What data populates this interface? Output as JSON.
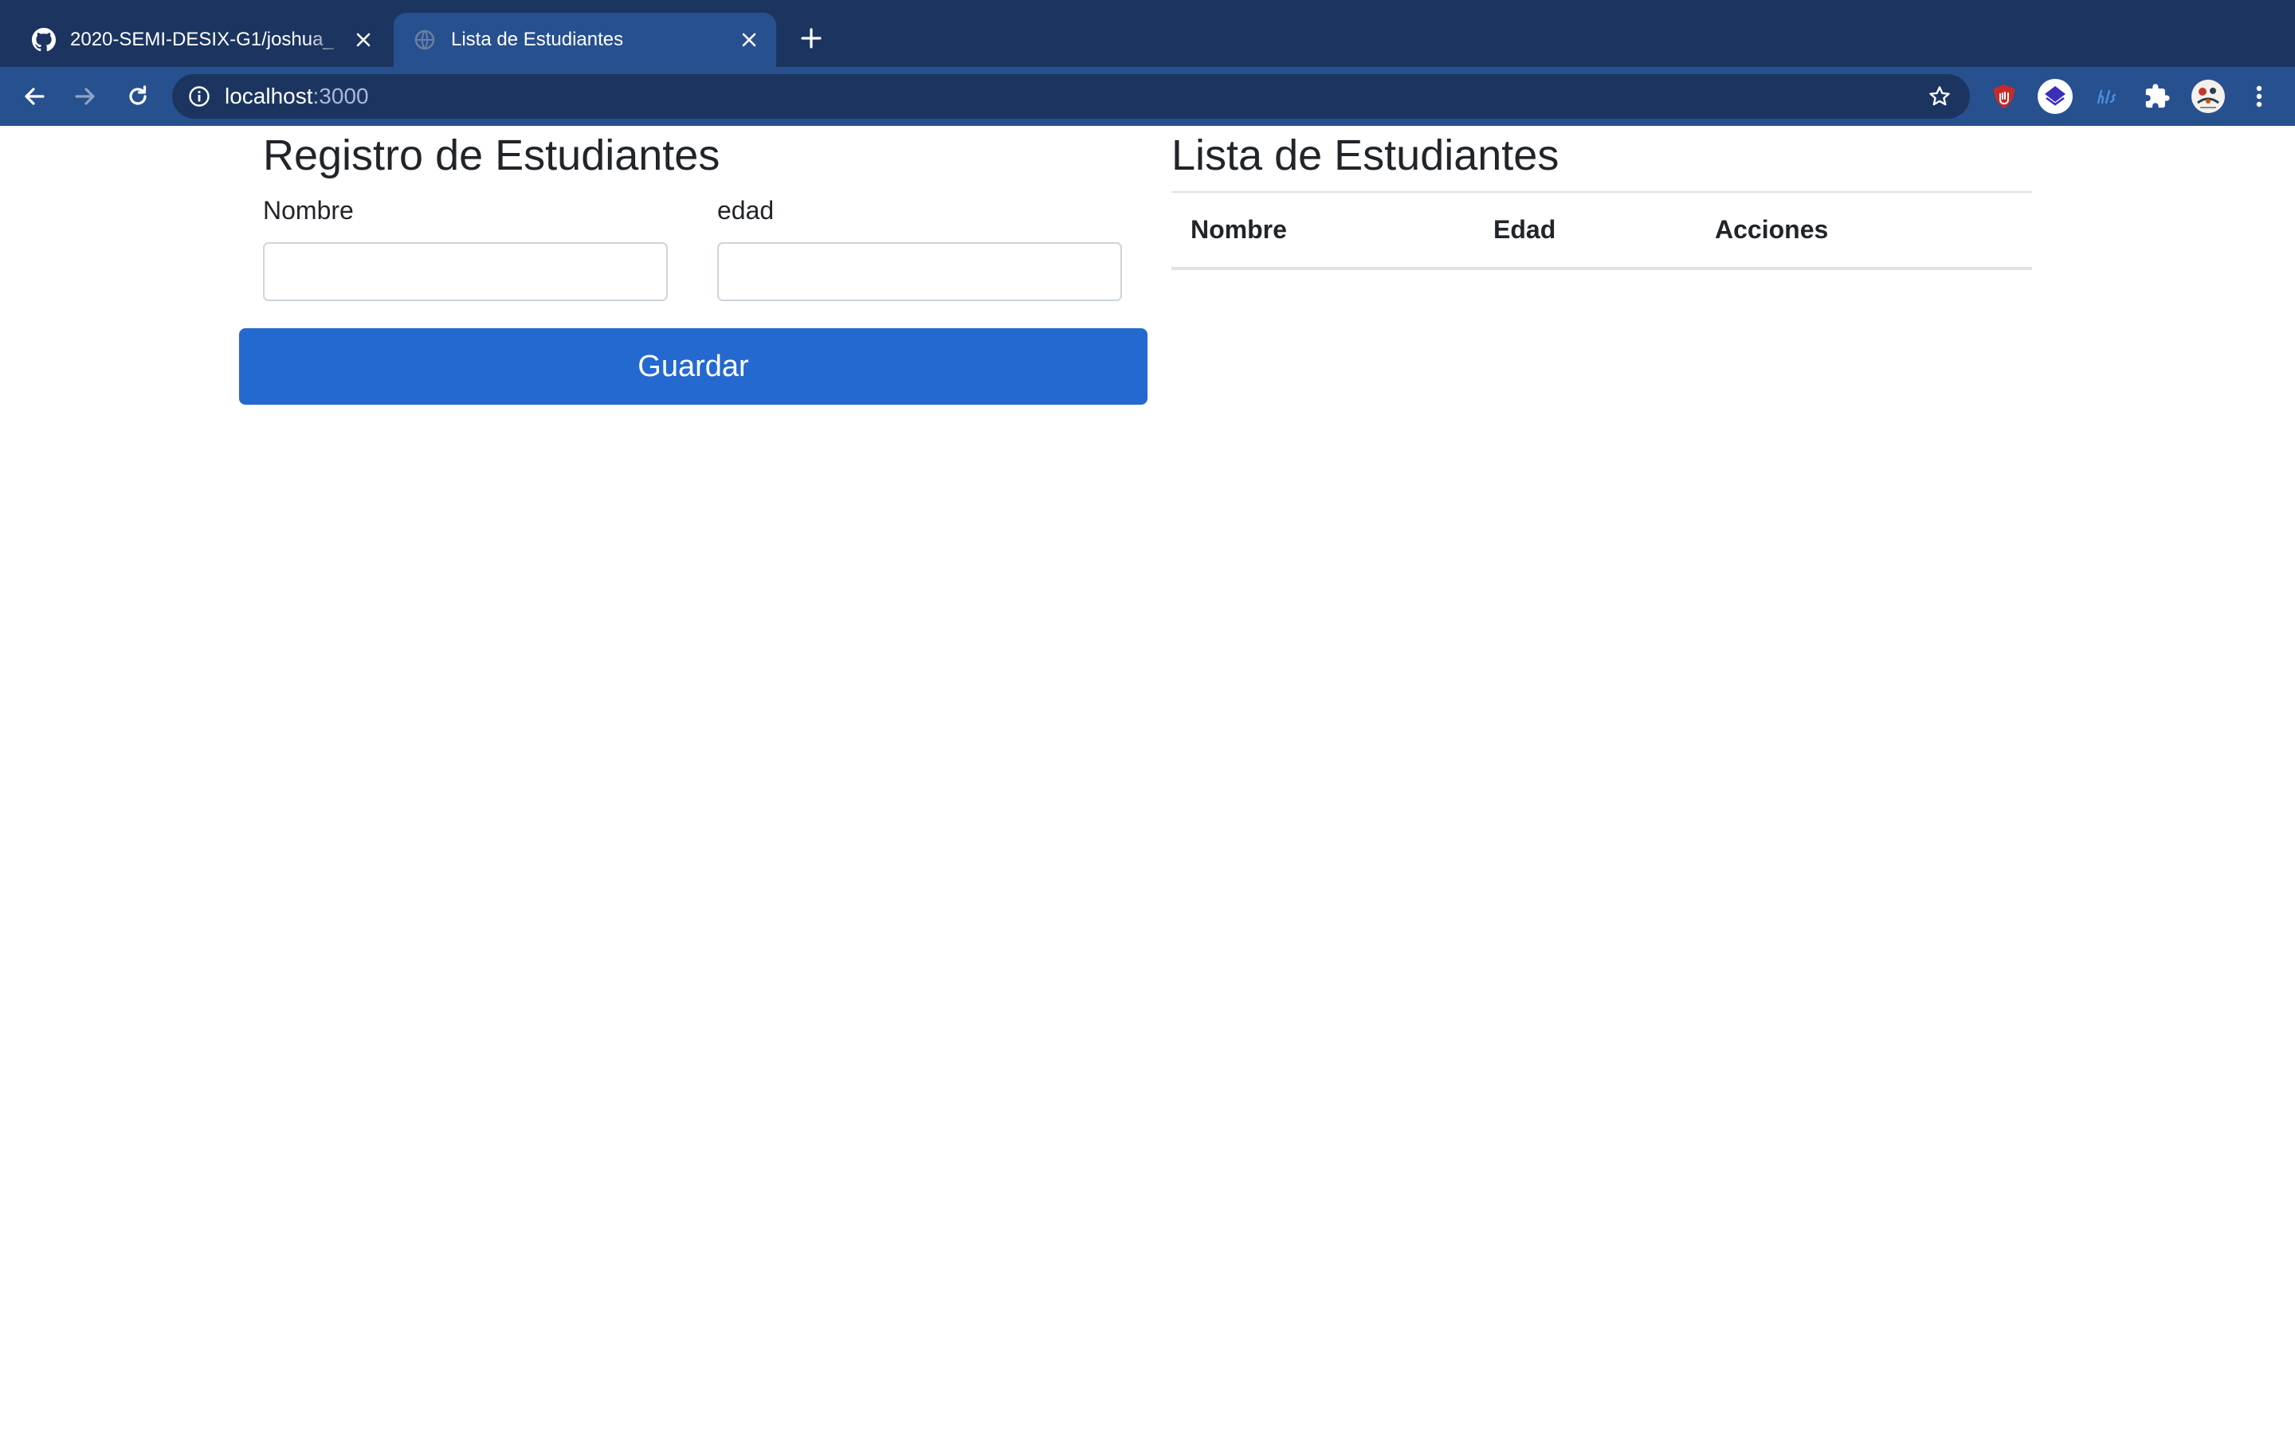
{
  "browser": {
    "tabs": [
      {
        "title": "2020-SEMI-DESIX-G1/joshua_",
        "favicon": "github-icon",
        "active": false
      },
      {
        "title": "Lista de Estudiantes",
        "favicon": "globe-icon",
        "active": true
      }
    ],
    "url": {
      "host": "localhost",
      "port": ":3000"
    },
    "extensions": [
      "ublock-icon",
      "layers-extension-icon",
      "hls-extension-icon",
      "puzzle-icon",
      "profile-avatar"
    ],
    "colors": {
      "tabbar": "#1b3560",
      "toolbar": "#27508f",
      "omnibox": "#1b3560"
    }
  },
  "form": {
    "title": "Registro de Estudiantes",
    "name_label": "Nombre",
    "name_value": "",
    "age_label": "edad",
    "age_value": "",
    "submit_label": "Guardar"
  },
  "list": {
    "title": "Lista de Estudiantes",
    "columns": [
      "Nombre",
      "Edad",
      "Acciones"
    ],
    "rows": []
  },
  "colors": {
    "primary_button": "#2469d0",
    "text": "#212529",
    "border": "#ced4da"
  }
}
